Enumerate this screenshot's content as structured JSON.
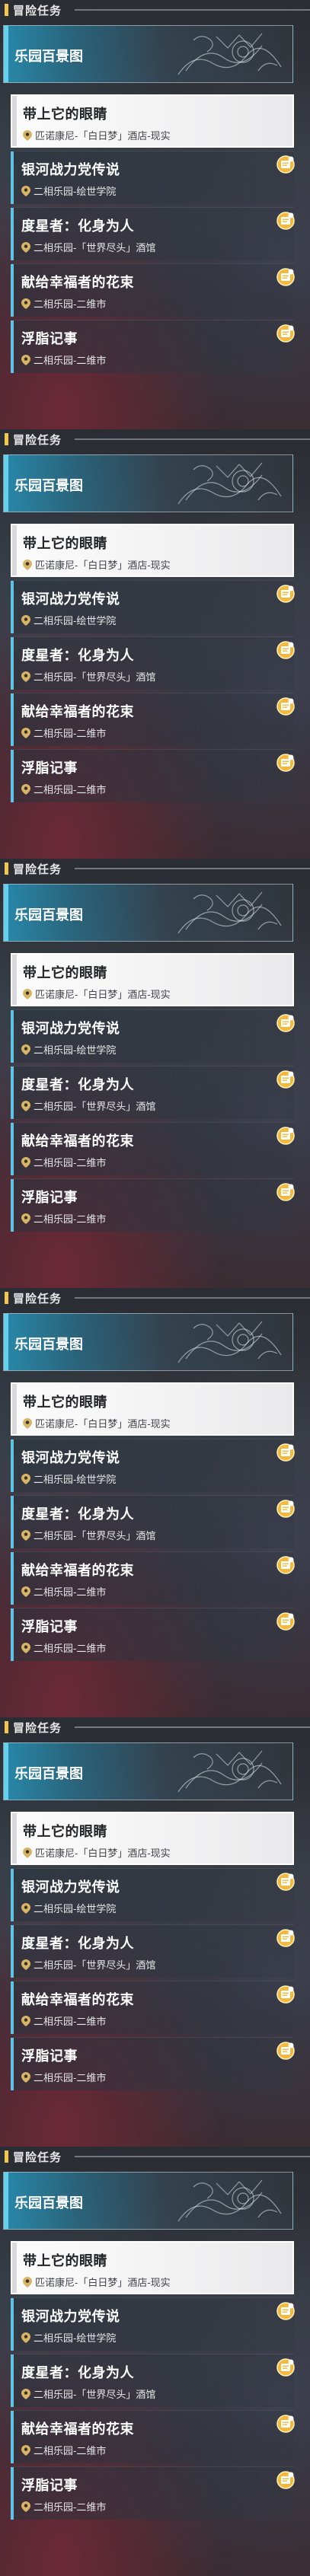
{
  "colors": {
    "header_accent": "#f3c64d",
    "gallery_accent": "#63d0ec",
    "quest_accent": "#5fc3e4",
    "badge_fill": "#f4b83a"
  },
  "panel": {
    "header": "冒险任务",
    "gallery_label": "乐园百景图",
    "quests": [
      {
        "title": "带上它的眼睛",
        "location": "匹诺康尼-「白日梦」酒店-现实",
        "selected": true,
        "badge_icon": "new-quest-icon"
      },
      {
        "title": "银河战力党传说",
        "location": "二相乐园-绘世学院",
        "selected": false,
        "badge_icon": "new-quest-icon"
      },
      {
        "title": "度星者：化身为人",
        "location": "二相乐园-「世界尽头」酒馆",
        "selected": false,
        "badge_icon": "new-quest-icon"
      },
      {
        "title": "献给幸福者的花束",
        "location": "二相乐园-二维市",
        "selected": false,
        "badge_icon": "new-quest-icon"
      },
      {
        "title": "浮脂记事",
        "location": "二相乐园-二维市",
        "selected": false,
        "badge_icon": "new-quest-icon"
      }
    ]
  }
}
